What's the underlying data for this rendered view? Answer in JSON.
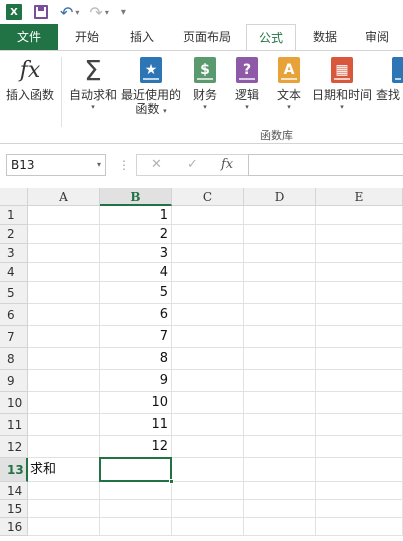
{
  "quick_access": {
    "app_icon": "excel-logo-icon",
    "app_letter": "X",
    "save_icon": "save-icon",
    "undo_icon": "undo-icon",
    "redo_icon": "redo-icon",
    "customize_icon": "customize-qat-icon",
    "undo_glyph": "↶",
    "redo_glyph": "↷",
    "drop_glyph": "▾",
    "customize_glyph": "▾"
  },
  "tabs": [
    {
      "label": "文件"
    },
    {
      "label": "开始"
    },
    {
      "label": "插入"
    },
    {
      "label": "页面布局"
    },
    {
      "label": "公式"
    },
    {
      "label": "数据"
    },
    {
      "label": "审阅"
    }
  ],
  "active_tab": "公式",
  "ribbon": {
    "group_label": "函数库",
    "insert_function": {
      "label": "插入函数",
      "glyph": "fx"
    },
    "autosum": {
      "label": "自动求和",
      "glyph": "Σ",
      "drop": "▾"
    },
    "recent": {
      "label_line1": "最近使用的",
      "label_line2": "函数",
      "glyph": "★",
      "drop": "▾"
    },
    "financial": {
      "label": "财务",
      "glyph": "$",
      "drop": "▾"
    },
    "logical": {
      "label": "逻辑",
      "glyph": "?",
      "drop": "▾"
    },
    "text": {
      "label": "文本",
      "glyph": "A",
      "drop": "▾"
    },
    "datetime": {
      "label": "日期和时间",
      "glyph": "▦",
      "drop": "▾"
    },
    "lookup": {
      "label": "查找",
      "drop": "▾"
    }
  },
  "formula_bar": {
    "name_box": "B13",
    "name_drop": "▾",
    "dots": "⋮",
    "cancel": "✕",
    "enter": "✓",
    "fx": "fx",
    "value": ""
  },
  "sheet": {
    "columns": [
      "A",
      "B",
      "C",
      "D",
      "E"
    ],
    "selected_column": "B",
    "rows": [
      "1",
      "2",
      "3",
      "4",
      "5",
      "6",
      "7",
      "8",
      "9",
      "10",
      "11",
      "12",
      "13",
      "14",
      "15",
      "16"
    ],
    "selected_row": "13",
    "b_values": [
      "1",
      "2",
      "3",
      "4",
      "5",
      "6",
      "7",
      "8",
      "9",
      "10",
      "11",
      "12"
    ],
    "a13": "求和",
    "active_cell": "B13"
  },
  "colors": {
    "excel_green": "#217346",
    "save_purple": "#7a4d9b",
    "recent_blue": "#2e75b6",
    "financial_green": "#5b9a6e",
    "logical_purple": "#8e5aa8",
    "text_orange": "#e8a23a",
    "datetime_red": "#d9573b"
  }
}
